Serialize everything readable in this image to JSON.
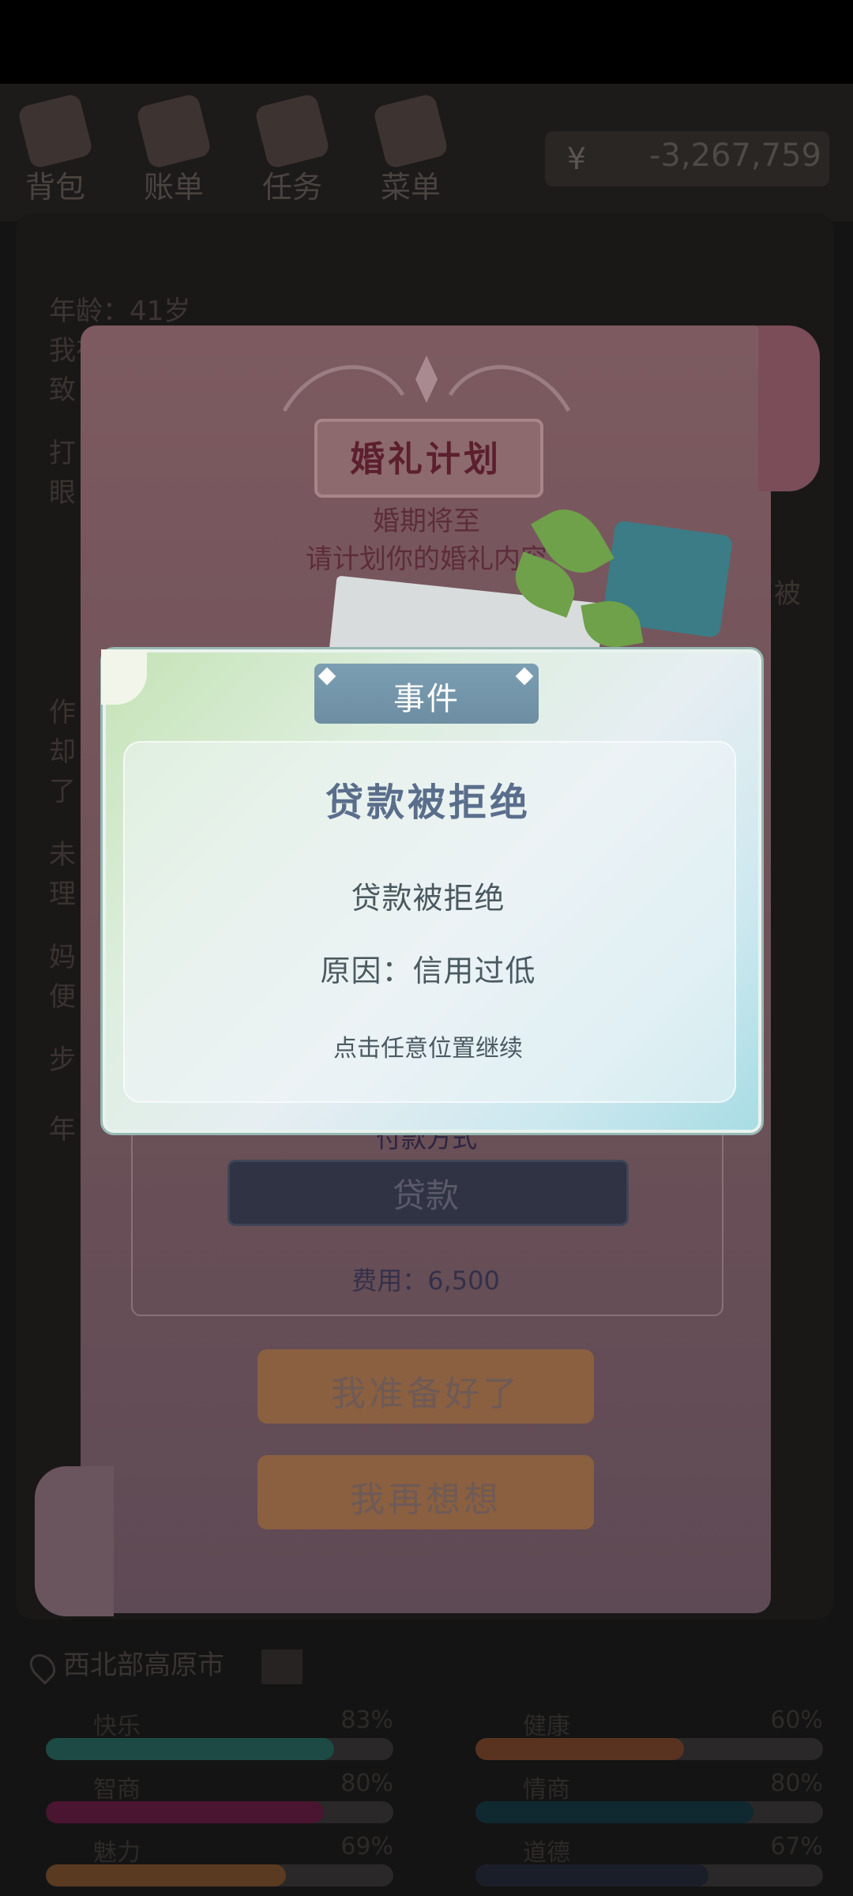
{
  "hud": {
    "items": [
      {
        "label": "背包",
        "icon": "backpack-icon"
      },
      {
        "label": "账单",
        "icon": "bill-icon"
      },
      {
        "label": "任务",
        "icon": "task-icon"
      },
      {
        "label": "菜单",
        "icon": "menu-icon"
      }
    ],
    "money_symbol": "¥",
    "money": "-3,267,759"
  },
  "story": {
    "age_line": "年龄：41岁",
    "partial_lines": [
      "我在",
      "致",
      "打",
      "眼",
      "作",
      "却",
      "了",
      "未",
      "理",
      "妈",
      "便",
      "步",
      "年"
    ],
    "right_fragment": "被"
  },
  "location": {
    "name": "西北部高原市"
  },
  "stats": [
    {
      "name": "快乐",
      "value": "83%",
      "level": 0.83,
      "color": "#1d4a44",
      "icon": "smile-icon"
    },
    {
      "name": "健康",
      "value": "60%",
      "level": 0.6,
      "color": "#5a3320",
      "icon": "heart-icon"
    },
    {
      "name": "智商",
      "value": "80%",
      "level": 0.8,
      "color": "#4a1530",
      "icon": "bulb-icon"
    },
    {
      "name": "情商",
      "value": "80%",
      "level": 0.8,
      "color": "#102830",
      "icon": "apple-icon"
    },
    {
      "name": "魅力",
      "value": "69%",
      "level": 0.69,
      "color": "#5a3a20",
      "icon": "star-icon"
    },
    {
      "name": "道德",
      "value": "67%",
      "level": 0.67,
      "color": "#1a1e28",
      "icon": "scale-icon"
    }
  ],
  "wedding": {
    "title": "婚礼计划",
    "subtitle1": "婚期将至",
    "subtitle2": "请计划你的婚礼内容",
    "pay_header": "付款方式",
    "loan_button": "贷款",
    "cost": "费用：6,500",
    "ready_button": "我准备好了",
    "rethink_button": "我再想想"
  },
  "event": {
    "tab": "事件",
    "title": "贷款被拒绝",
    "line1": "贷款被拒绝",
    "line2": "原因：信用过低",
    "hint": "点击任意位置继续"
  },
  "colors": {
    "event_title": "#5a6e8c",
    "wedding_title": "#5c1f2e",
    "event_tab": "#7c9eb2"
  }
}
